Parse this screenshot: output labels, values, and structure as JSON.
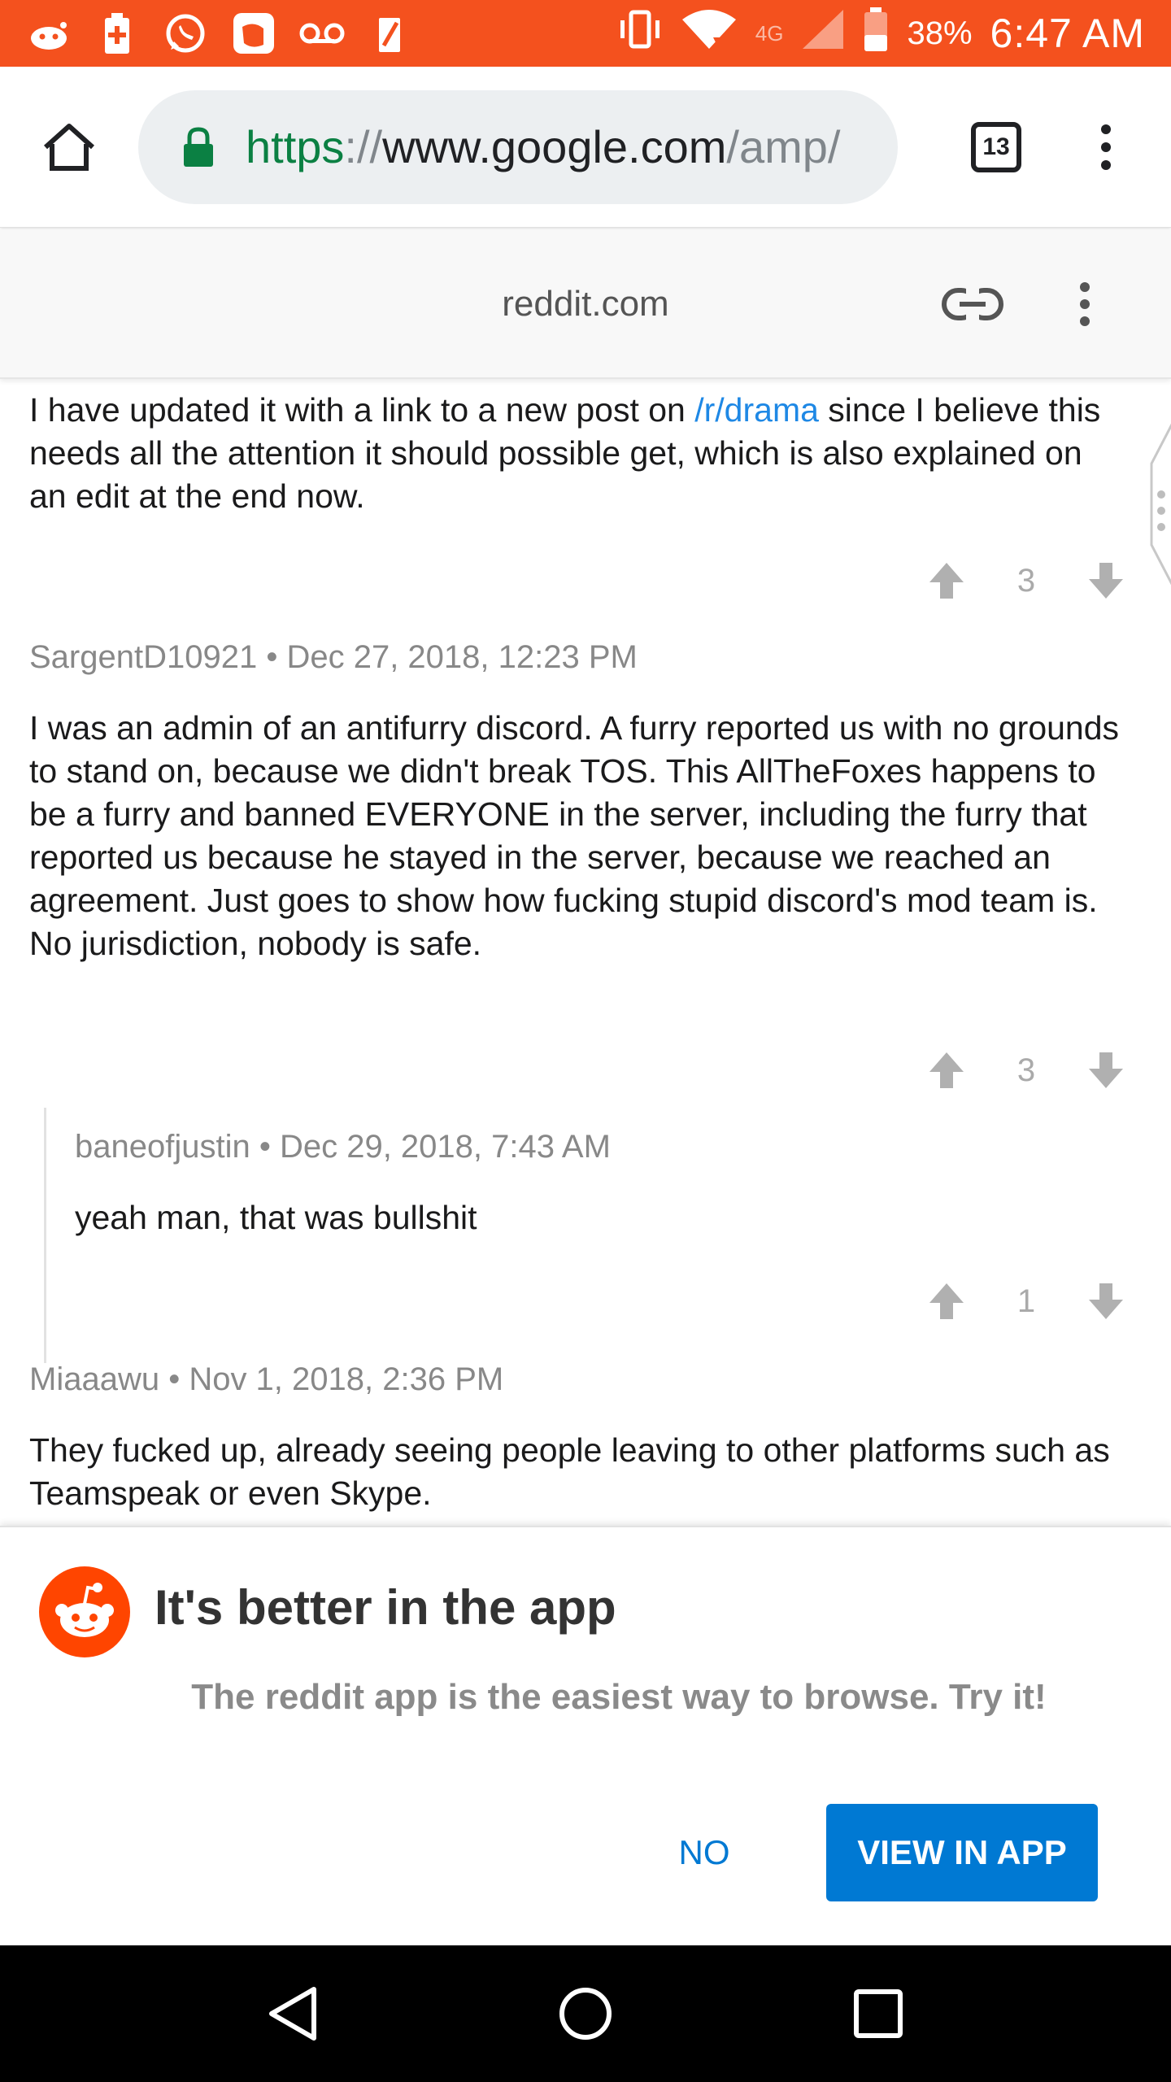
{
  "status_bar": {
    "battery_pct": "38%",
    "time": "6:47 AM",
    "network": "4G",
    "left_icons": [
      "reddit-icon",
      "battery-plus-icon",
      "whatsapp-icon",
      "messenger-icon",
      "voicemail-icon",
      "edit-icon"
    ]
  },
  "browser": {
    "url_scheme": "https",
    "url_sep": "://",
    "url_host": "www.google.com",
    "url_path": "/amp/",
    "tab_count": "13"
  },
  "amp_header": {
    "domain": "reddit.com"
  },
  "comments": {
    "top_partial": {
      "text_before_link": "I have updated it with a link to a new post on ",
      "link_text": "/r/drama",
      "text_after_link": " since I believe this needs all the attention it should possible get, which is also explained on an edit at the end now.",
      "score": "3"
    },
    "c1": {
      "author": "SargentD10921",
      "date": "Dec 27, 2018, 12:23 PM",
      "text": "I was an admin of an antifurry discord. A furry reported us with no grounds to stand on, because we didn't break TOS. This AllTheFoxes happens to be a furry and banned EVERYONE in the server, including the furry that reported us because he stayed in the server, because we reached an agreement. Just goes to show how fucking stupid discord's mod team is. No jurisdiction, nobody is safe.",
      "score": "3"
    },
    "c1_reply": {
      "author": "baneofjustin",
      "date": "Dec 29, 2018, 7:43 AM",
      "text": "yeah man, that was bullshit",
      "score": "1"
    },
    "c2": {
      "author": "Miaaawu",
      "date": "Nov 1, 2018, 2:36 PM",
      "text": "They fucked up, already seeing people leaving to other platforms such as Teamspeak or even Skype."
    },
    "separator": " • "
  },
  "app_banner": {
    "title": "It's better in the app",
    "subtitle": "The reddit app is the easiest way to browse. Try it!",
    "no_label": "NO",
    "view_label": "VIEW IN APP"
  },
  "colors": {
    "status_bar": "#f4511e",
    "link": "#1e88e5",
    "reddit_orange": "#ff4500",
    "button_blue": "#0079d3"
  }
}
